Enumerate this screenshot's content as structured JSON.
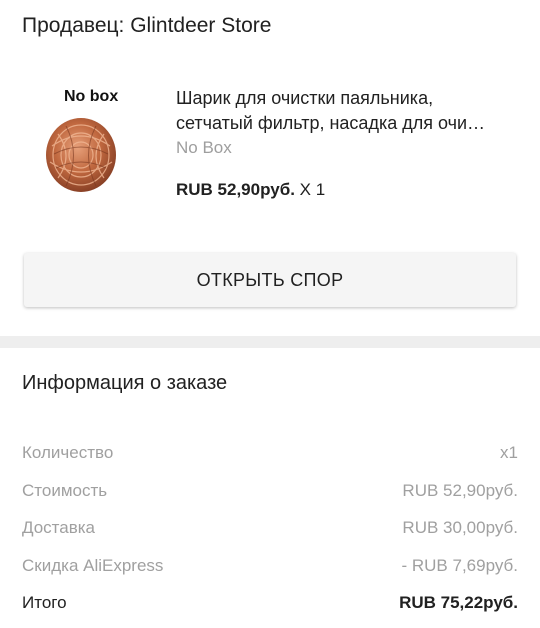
{
  "seller": {
    "label": "Продавец: Glintdeer Store"
  },
  "product": {
    "image_caption": "No box",
    "title_line1": "Шарик для очистки паяльника,",
    "title_line2": "сетчатый фильтр, насадка для очи…",
    "variant": "No Box",
    "price": "RUB 52,90руб.",
    "quantity": "X 1"
  },
  "actions": {
    "open_dispute": "ОТКРЫТЬ СПОР"
  },
  "order_info": {
    "title": "Информация о заказе",
    "rows": [
      {
        "label": "Количество",
        "value": "x1"
      },
      {
        "label": "Стоимость",
        "value": "RUB 52,90руб."
      },
      {
        "label": "Доставка",
        "value": "RUB 30,00руб."
      },
      {
        "label": "Скидка AliExpress",
        "value": "- RUB 7,69руб."
      },
      {
        "label": "Итого",
        "value": "RUB 75,22руб."
      }
    ]
  },
  "colors": {
    "text": "#212121",
    "muted": "#9e9e9e",
    "divider": "#eeeeee",
    "button_bg": "#f5f5f5"
  }
}
